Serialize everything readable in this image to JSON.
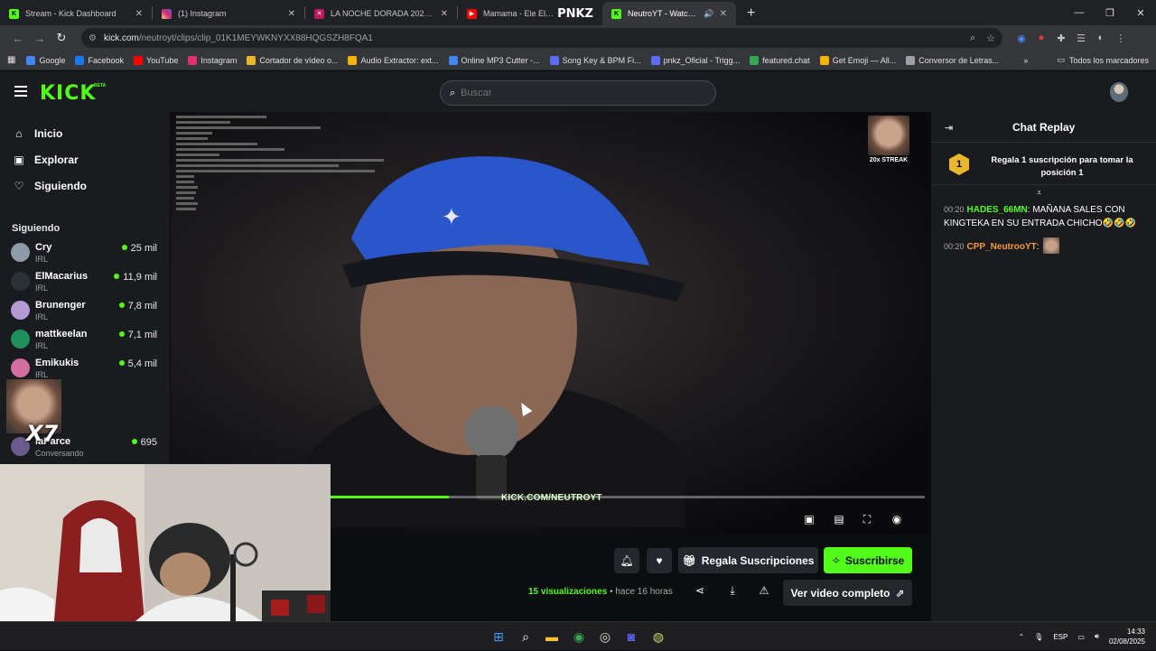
{
  "browser": {
    "tabs": [
      {
        "title": "Stream - Kick Dashboard",
        "color": "#53fc18",
        "icon": "kick-favicon-icon",
        "active": false
      },
      {
        "title": "(1) Instagram",
        "color": "#e1306c",
        "icon": "instagram-favicon-icon",
        "active": false
      },
      {
        "title": "LA NOCHE DORADA 2025 | TE",
        "color": "#e1306c",
        "icon": "page-favicon-icon",
        "active": false
      },
      {
        "title": "Mamama - Ele El Mu",
        "color": "#ff0000",
        "icon": "youtube-favicon-icon",
        "active": false
      },
      {
        "title": "NeutroYT - Watch clips on",
        "color": "#53fc18",
        "icon": "kick-favicon-icon",
        "active": true
      }
    ],
    "tab_overlay_text": "PNKZ",
    "url_host": "kick.com",
    "url_path": "/neutroyt/clips/clip_01K1MEYWKNYXX88HQGSZH8FQA1",
    "bookmarks": [
      {
        "label": "Google",
        "color": "#4285f4"
      },
      {
        "label": "Facebook",
        "color": "#1877f2"
      },
      {
        "label": "YouTube",
        "color": "#ff0000"
      },
      {
        "label": "Instagram",
        "color": "#e1306c"
      },
      {
        "label": "Cortador de vídeo o...",
        "color": "#e9b82a"
      },
      {
        "label": "Audio Extractor: ext...",
        "color": "#f4b400"
      },
      {
        "label": "Online MP3 Cutter -...",
        "color": "#4285f4"
      },
      {
        "label": "Song Key & BPM Fi...",
        "color": "#5b6cff"
      },
      {
        "label": "pnkz_Oficial - Trigg...",
        "color": "#5b6cff"
      },
      {
        "label": "featured.chat",
        "color": "#34a853"
      },
      {
        "label": "Get Emoji — All...",
        "color": "#f4b400"
      },
      {
        "label": "Conversor de Letras...",
        "color": "#9aa0a6"
      }
    ],
    "all_bookmarks_label": "Todos los marcadores"
  },
  "kick": {
    "logo": "KICK",
    "logo_badge": "BETA",
    "search_placeholder": "Buscar",
    "nav": [
      {
        "label": "Inicio",
        "icon": "home-icon"
      },
      {
        "label": "Explorar",
        "icon": "explore-icon"
      },
      {
        "label": "Siguiendo",
        "icon": "heart-icon"
      }
    ],
    "following_title": "Siguiendo",
    "following": [
      {
        "name": "Cry",
        "category": "IRL",
        "viewers": "25 mil",
        "color": "#8d9aa8"
      },
      {
        "name": "ElMacarius",
        "category": "IRL",
        "viewers": "11,9 mil",
        "color": "#2b2f36"
      },
      {
        "name": "Brunenger",
        "category": "IRL",
        "viewers": "7,8 mil",
        "color": "#b59bd6"
      },
      {
        "name": "mattkeelan",
        "category": "IRL",
        "viewers": "7,1 mil",
        "color": "#1f8f5a"
      },
      {
        "name": "Emikukis",
        "category": "IRL",
        "viewers": "5,4 mil",
        "color": "#d36fa0"
      },
      {
        "name": "",
        "category": "ado",
        "viewers": "",
        "color": "#444"
      },
      {
        "name": "laParce",
        "category": "Conversando",
        "viewers": "695",
        "color": "#6a5b8c"
      }
    ],
    "video": {
      "streak_label": "20x STREAK",
      "watermark": "KICK.COM/NEUTROYT",
      "progress": 0.2,
      "emote_overlay": "X7"
    },
    "actions": {
      "gift_label": "Regala Suscripciones",
      "subscribe_label": "Suscribirse",
      "views_count": "15",
      "views_label": "visualizaciones",
      "time_ago": "• hace 16 horas",
      "full_video_label": "Ver video completo"
    },
    "chat": {
      "title": "Chat Replay",
      "rank_number": "1",
      "rank_text": "Regala 1 suscripción para tomar la posición 1",
      "messages": [
        {
          "time": "00:20",
          "user": "HADES_66MN",
          "user_color": "#53fc18",
          "text": ": MAÑANA SALES CON KINGTEKA EN SU ENTRADA CHICHO🤣🤣🤣"
        },
        {
          "time": "00:20",
          "user": "CPP_NeutrooYT",
          "user_color": "#f29b38",
          "text": ":"
        }
      ]
    }
  },
  "taskbar": {
    "lang": "ESP",
    "time": "14:33",
    "date": "02/08/2025"
  }
}
